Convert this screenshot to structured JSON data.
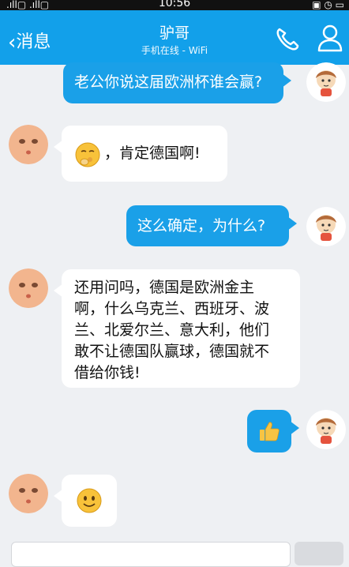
{
  "status_bar": {
    "signal_left": ".ıll▢ .ıll▢",
    "time": "10:56",
    "icons_right": "▣ ◷ ▭"
  },
  "header": {
    "back_label": "消息",
    "title": "驴哥",
    "subtitle": "手机在线 - WiFi"
  },
  "messages": [
    {
      "side": "me",
      "text": "老公你说这届欧洲杯谁会赢?"
    },
    {
      "side": "them",
      "text": "，肯定德国啊!"
    },
    {
      "side": "me",
      "text": "这么确定，为什么?"
    },
    {
      "side": "them",
      "lines": [
        "还用问吗，德国是欧洲金主",
        "啊，什么乌克兰、西班牙、波",
        "兰、北爱尔兰、意大利，他们",
        "敢不让德国队赢球，德国就不",
        "借给你钱!"
      ]
    },
    {
      "side": "me",
      "text": ""
    },
    {
      "side": "them",
      "text": ""
    }
  ],
  "colors": {
    "header_bg": "#12A0EA",
    "bubble_me": "#1AA0E8",
    "bubble_them": "#FFFFFF",
    "chat_bg": "#EEF0F3"
  },
  "icons": [
    "back-chevron-icon",
    "phone-icon",
    "profile-icon",
    "thinking-emoji-icon",
    "thumbs-up-icon",
    "smile-emoji-icon"
  ]
}
